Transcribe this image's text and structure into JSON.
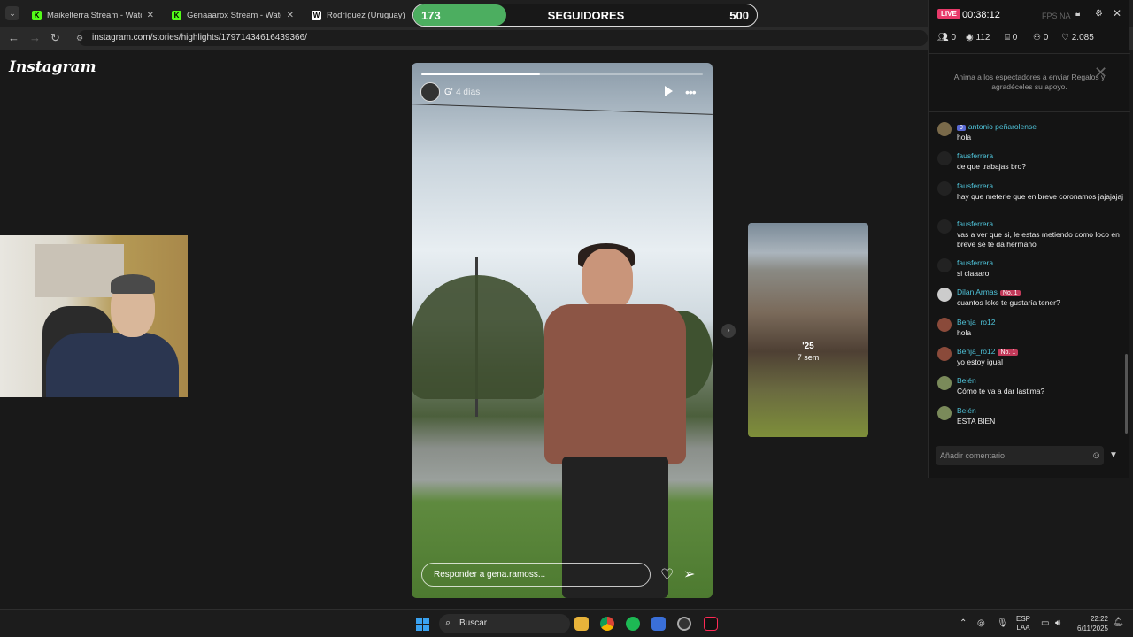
{
  "browser": {
    "tabs": [
      {
        "label": "Maikelterra Stream - Watch Live",
        "favicon_color": "#53fc18",
        "favicon_letter": "K"
      },
      {
        "label": "Genaaarox Stream - Watch Live",
        "favicon_color": "#53fc18",
        "favicon_letter": "K"
      },
      {
        "label": "Rodríguez (Uruguay) - Wikipe",
        "favicon_color": "#ffffff",
        "favicon_letter": "W"
      }
    ],
    "url": "instagram.com/stories/highlights/17971434616439366/"
  },
  "instagram": {
    "logo": "Instagram",
    "story": {
      "username": "G'",
      "time": "4 días",
      "progress": 0.42,
      "reply_placeholder": "Responder a gena.ramoss..."
    },
    "next_story": {
      "year": "'25",
      "time": "7 sem"
    }
  },
  "follower_goal": {
    "current": "173",
    "label": "SEGUIDORES",
    "goal": "500",
    "fill_fraction": 0.27,
    "color": "#4cae60"
  },
  "stream_panel": {
    "live_label": "LIVE",
    "duration": "00:38:12",
    "fps_label": "FPS",
    "fps_suffix": "NA",
    "stats": {
      "people": "0",
      "viewers": "112",
      "gifts": "0",
      "shares": "0",
      "likes": "2.085"
    },
    "gift_message": "Anima a los espectadores a enviar Regalos y agradéceles su apoyo.",
    "comments": [
      {
        "user": "antonio peñarolense",
        "badge": "9",
        "badge_color": "#5a6ad4",
        "text": "hola",
        "avatar": "#7a6a4a"
      },
      {
        "user": "fausferrera",
        "badge": "",
        "badge_color": "",
        "text": "de que trabajas bro?",
        "avatar": "#222222"
      },
      {
        "user": "fausferrera",
        "badge": "",
        "badge_color": "",
        "text": "hay que meterle que en breve coronamos jajajajaj",
        "avatar": "#222222"
      },
      {
        "user": "fausferrera",
        "badge": "",
        "badge_color": "",
        "text": "vas a ver que si, le estas metiendo como loco en breve se te da hermano",
        "avatar": "#222222"
      },
      {
        "user": "fausferrera",
        "badge": "",
        "badge_color": "",
        "text": "si claaaro",
        "avatar": "#222222"
      },
      {
        "user": "Dilan Armas",
        "badge": "No. 1",
        "badge_color": "#c23a5a",
        "text": "cuantos loke te gustaría tener?",
        "avatar": "#cccccc"
      },
      {
        "user": "Benja_ro12",
        "badge": "",
        "badge_color": "",
        "text": "hola",
        "avatar": "#8a4a3a"
      },
      {
        "user": "Benja_ro12",
        "badge": "No. 1",
        "badge_color": "#c23a5a",
        "text": "yo estoy igual",
        "avatar": "#8a4a3a"
      },
      {
        "user": "Belén",
        "badge": "",
        "badge_color": "",
        "text": "Cómo te va a dar lastima?",
        "avatar": "#7a8a5a"
      },
      {
        "user": "Belén",
        "badge": "",
        "badge_color": "",
        "text": "ESTA BIEN",
        "avatar": "#7a8a5a"
      }
    ],
    "comment_placeholder": "Añadir comentario"
  },
  "taskbar": {
    "search_label": "Buscar",
    "lang": "ESP",
    "lang2": "LAA",
    "time": "22:22",
    "date": "6/11/2025"
  }
}
